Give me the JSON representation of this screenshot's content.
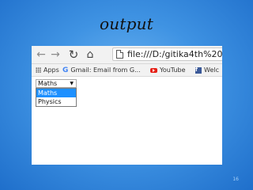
{
  "slide": {
    "title": "output",
    "page_number": "16"
  },
  "browser": {
    "nav": {
      "back_icon": "back-arrow-icon",
      "forward_icon": "forward-arrow-icon",
      "reload_icon": "reload-icon",
      "home_icon": "home-icon"
    },
    "url": "file:///D:/gitika4th%20sem/l",
    "bookmarks": [
      {
        "label": "Apps",
        "icon": "apps-grid-icon"
      },
      {
        "label": "Gmail: Email from G...",
        "icon": "google-g-icon",
        "icon2": "gmail-icon"
      },
      {
        "label": "YouTube",
        "icon": "youtube-icon"
      },
      {
        "label": "Welc",
        "icon": "facebook-icon"
      }
    ]
  },
  "page": {
    "select": {
      "value": "Maths",
      "options": [
        "Maths",
        "Physics"
      ],
      "selected_index": 0,
      "highlight_color": "#1e90ff"
    }
  }
}
